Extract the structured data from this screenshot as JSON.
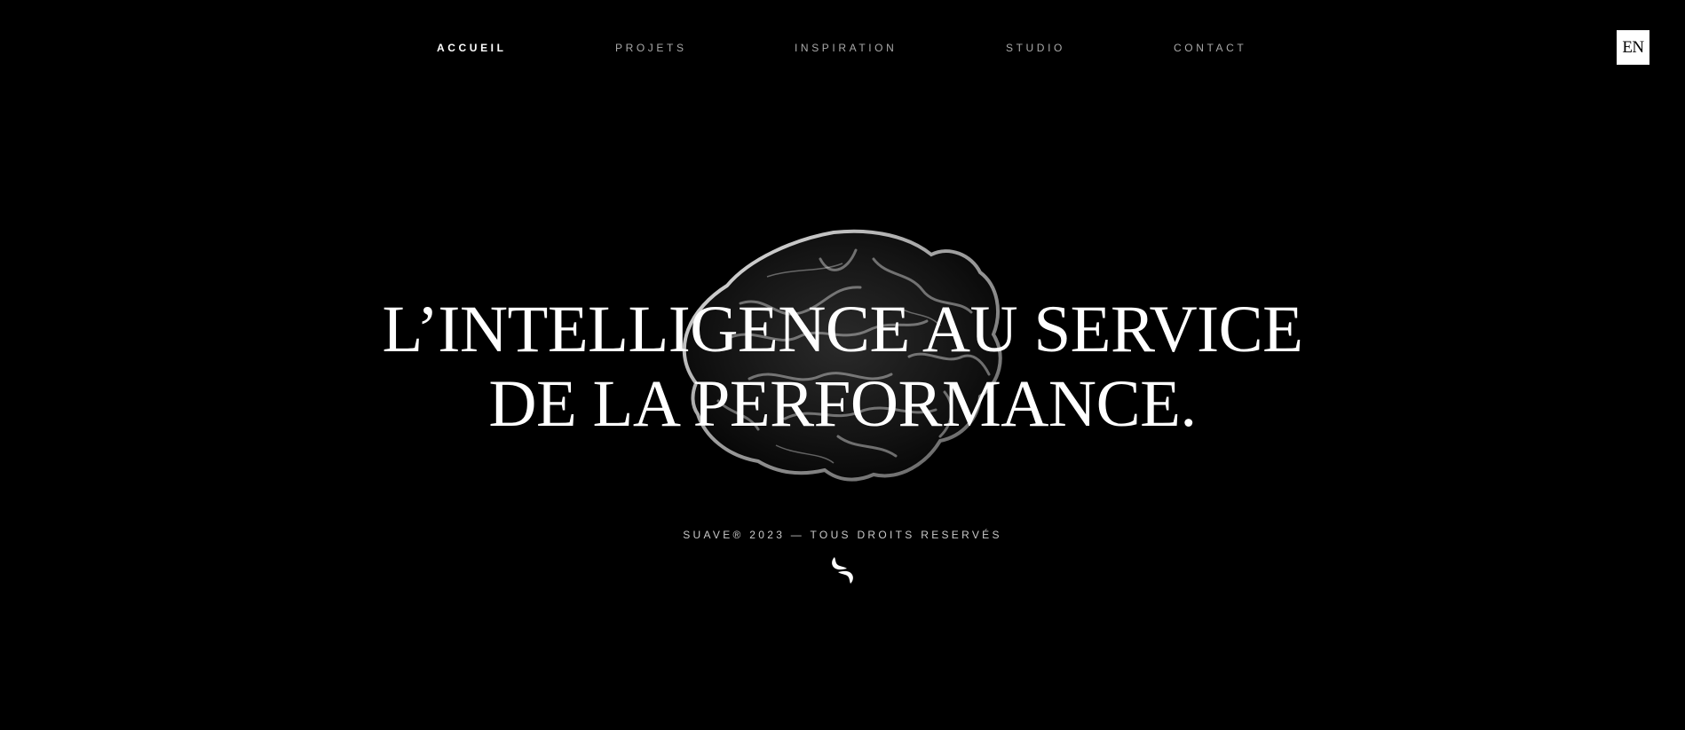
{
  "nav": {
    "items": [
      {
        "label": "ACCUEIL",
        "active": true
      },
      {
        "label": "PROJETS",
        "active": false
      },
      {
        "label": "INSPIRATION",
        "active": false
      },
      {
        "label": "STUDIO",
        "active": false
      },
      {
        "label": "CONTACT",
        "active": false
      }
    ]
  },
  "language_toggle": {
    "label": "EN"
  },
  "hero": {
    "headline_line1": "L’INTELLIGENCE AU SERVICE",
    "headline_line2": "DE LA PERFORMANCE.",
    "background_image": "brain-icon"
  },
  "footer": {
    "copyright": "SUAVE® 2023 — TOUS DROITS RESERVÉS",
    "logo_icon": "suave-logo-icon"
  },
  "colors": {
    "background": "#000000",
    "text": "#ffffff",
    "nav_inactive": "#a9a9a9",
    "lang_button_bg": "#ffffff",
    "lang_button_text": "#000000"
  }
}
